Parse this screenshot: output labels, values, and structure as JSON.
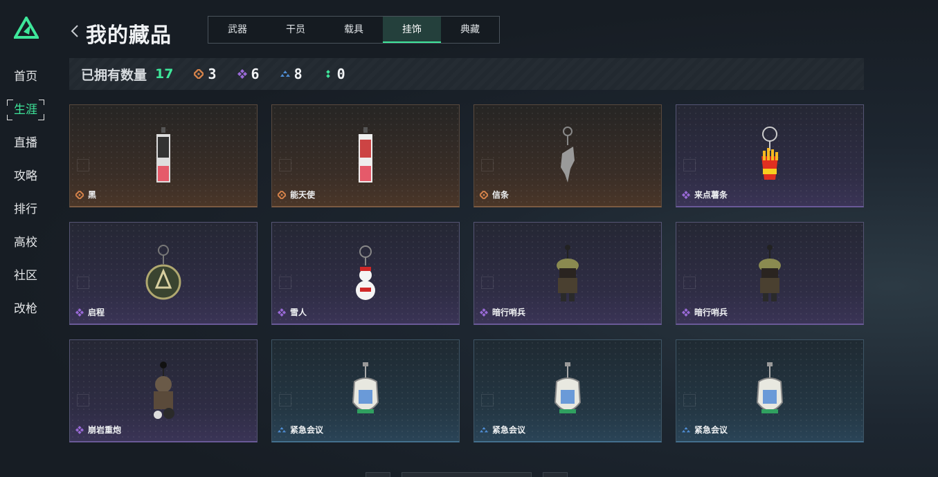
{
  "sidebar": {
    "items": [
      {
        "label": "首页",
        "active": false
      },
      {
        "label": "生涯",
        "active": true
      },
      {
        "label": "直播",
        "active": false
      },
      {
        "label": "攻略",
        "active": false
      },
      {
        "label": "排行",
        "active": false
      },
      {
        "label": "高校",
        "active": false
      },
      {
        "label": "社区",
        "active": false
      },
      {
        "label": "改枪",
        "active": false
      }
    ]
  },
  "header": {
    "title": "我的藏品",
    "tabs": [
      {
        "label": "武器",
        "active": false
      },
      {
        "label": "干员",
        "active": false
      },
      {
        "label": "载具",
        "active": false
      },
      {
        "label": "挂饰",
        "active": true
      },
      {
        "label": "典藏",
        "active": false
      }
    ]
  },
  "summary": {
    "label": "已拥有数量",
    "total": "17",
    "rarities": [
      {
        "icon": "orange-diamond-icon",
        "color": "#d4824a",
        "count": "3"
      },
      {
        "icon": "purple-diamond-icon",
        "color": "#9a6ad8",
        "count": "6"
      },
      {
        "icon": "blue-triangle-icon",
        "color": "#4f8ed6",
        "count": "8"
      },
      {
        "icon": "green-dots-icon",
        "color": "#3ee69a",
        "count": "0"
      }
    ]
  },
  "items": [
    {
      "name": "黑",
      "rarity": "orange",
      "art": "poster-pendant-icon"
    },
    {
      "name": "能天使",
      "rarity": "orange",
      "art": "poster-pendant-icon"
    },
    {
      "name": "信条",
      "rarity": "orange",
      "art": "hand-pendant-icon"
    },
    {
      "name": "来点薯条",
      "rarity": "purple",
      "art": "fries-pendant-icon"
    },
    {
      "name": "启程",
      "rarity": "purple",
      "art": "medal-pendant-icon"
    },
    {
      "name": "雪人",
      "rarity": "purple",
      "art": "snowman-pendant-icon"
    },
    {
      "name": "暗行哨兵",
      "rarity": "purple",
      "art": "soldier-pendant-icon"
    },
    {
      "name": "暗行哨兵",
      "rarity": "purple",
      "art": "soldier-pendant-icon"
    },
    {
      "name": "崩岩重炮",
      "rarity": "purple",
      "art": "gunner-pendant-icon"
    },
    {
      "name": "紧急会议",
      "rarity": "blue",
      "art": "badge-pendant-icon"
    },
    {
      "name": "紧急会议",
      "rarity": "blue",
      "art": "badge-pendant-icon"
    },
    {
      "name": "紧急会议",
      "rarity": "blue",
      "art": "badge-pendant-icon"
    }
  ],
  "colors": {
    "accent": "#3ee69a",
    "orange": "#d4824a",
    "purple": "#9a6ad8",
    "blue": "#4f8ed6"
  }
}
